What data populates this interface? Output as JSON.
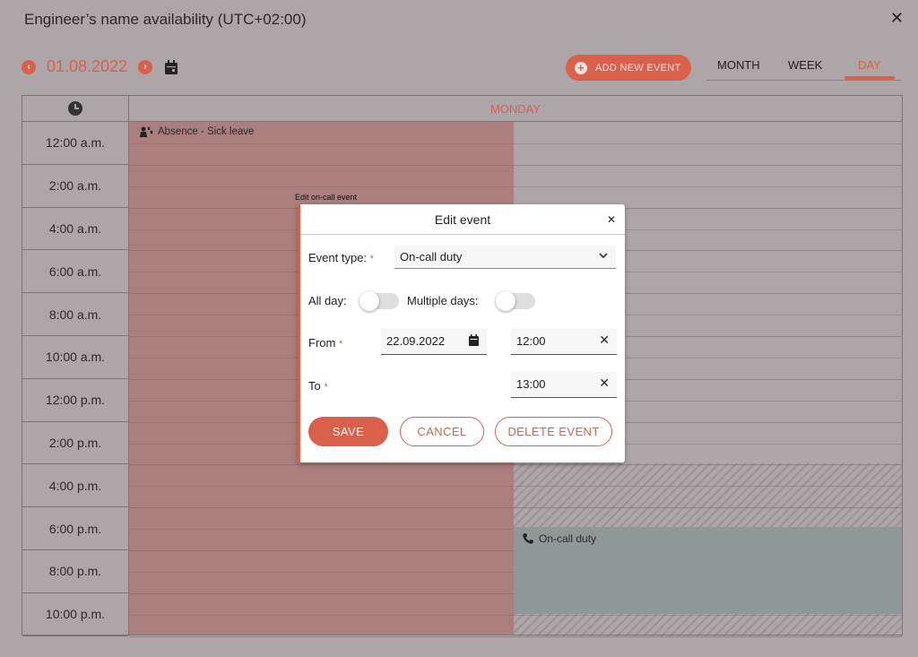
{
  "header": {
    "title": "Engineer’s name availability  (UTC+02:00)",
    "close_glyph": "✕"
  },
  "nav": {
    "prev_glyph": "‹",
    "next_glyph": "›",
    "date": "01.08.2022"
  },
  "toolbar": {
    "add_event_label": "ADD NEW EVENT",
    "add_glyph": "+"
  },
  "views": {
    "month": "MONTH",
    "week": "WEEK",
    "day": "DAY",
    "active": "DAY"
  },
  "calendar": {
    "day_header": "MONDAY",
    "times": [
      "12:00 a.m.",
      "2:00 a.m.",
      "4:00 a.m.",
      "6:00 a.m.",
      "8:00 a.m.",
      "10:00 a.m.",
      "12:00 p.m.",
      "2:00 p.m.",
      "4:00 p.m.",
      "6:00 p.m.",
      "8:00 p.m.",
      "10:00 p.m."
    ],
    "absence_label": "Absence - Sick leave",
    "oncall_label": "On-call duty",
    "tooltip": "Edit on-call event"
  },
  "modal": {
    "title": "Edit event",
    "close_glyph": "✕",
    "event_type_label": "Event type:",
    "required_mark": "*",
    "event_type_value": "On-call duty",
    "all_day_label": "All day:",
    "multiple_days_label": "Multiple days:",
    "all_day_on": false,
    "multiple_days_on": false,
    "from_label": "From",
    "to_label": "To",
    "from_date": "22.09.2022",
    "from_time": "12:00",
    "to_time": "13:00",
    "clear_glyph": "✕",
    "save_label": "SAVE",
    "cancel_label": "CANCEL",
    "delete_label": "DELETE EVENT"
  },
  "colors": {
    "accent": "#d9604b",
    "background": "#ada5a7",
    "absence": "#a8605c",
    "oncall": "#8f9899"
  }
}
